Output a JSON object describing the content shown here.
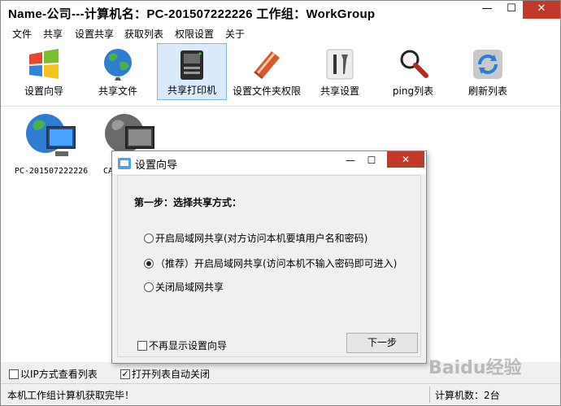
{
  "window": {
    "title": "Name-公司---计算机名：PC-201507222226  工作组：WorkGroup",
    "min_glyph": "—",
    "max_glyph": "☐",
    "close_glyph": "✕"
  },
  "menu": [
    "文件",
    "共享",
    "设置共享",
    "获取列表",
    "权限设置",
    "关于"
  ],
  "toolbar": [
    {
      "label": "设置向导",
      "icon": "windows-logo-icon"
    },
    {
      "label": "共享文件",
      "icon": "globe-icon"
    },
    {
      "label": "共享打印机",
      "icon": "printer-icon",
      "active": true
    },
    {
      "label": "设置文件夹权限",
      "icon": "book-icon"
    },
    {
      "label": "共享设置",
      "icon": "tools-icon"
    },
    {
      "label": "ping列表",
      "icon": "magnifier-icon"
    },
    {
      "label": "刷新列表",
      "icon": "refresh-icon"
    }
  ],
  "computers": [
    {
      "name": "PC-201507222226"
    },
    {
      "name": "CA"
    }
  ],
  "bottom_options": {
    "ip_view_label": "以IP方式查看列表",
    "ip_view_checked": false,
    "auto_close_label": "打开列表自动关闭",
    "auto_close_checked": true
  },
  "status": {
    "left": "本机工作组计算机获取完毕！",
    "right": "计算机数：2台"
  },
  "dialog": {
    "title": "设置向导",
    "min_glyph": "—",
    "max_glyph": "☐",
    "close_glyph": "✕",
    "step_label": "第一步：选择共享方式：",
    "options": [
      {
        "label": "开启局域网共享(对方访问本机要填用户名和密码)",
        "selected": false
      },
      {
        "label": "（推荐）开启局域网共享(访问本机不输入密码即可进入)",
        "selected": true
      },
      {
        "label": "关闭局域网共享",
        "selected": false
      }
    ],
    "no_show_label": "不再显示设置向导",
    "no_show_checked": false,
    "next_label": "下一步"
  },
  "watermark": "Baidu经验",
  "colors": {
    "close_red": "#c0392b",
    "active_border": "#7eb4ea",
    "active_bg": "#dbeafb"
  }
}
